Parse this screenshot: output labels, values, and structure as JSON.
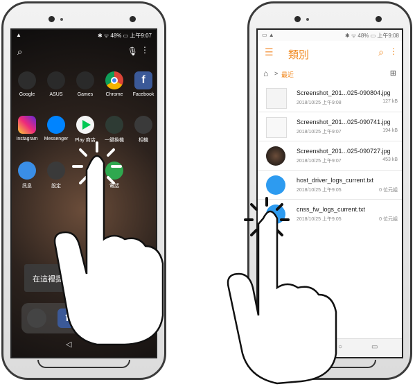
{
  "left_phone": {
    "status": {
      "left": "▲",
      "right": "✱ ᯤ 48% ▭ 上午9:07"
    },
    "apps": [
      {
        "label": "Google",
        "color": "#2d2d2d",
        "icon": "google-folder-icon"
      },
      {
        "label": "ASUS",
        "color": "#2a2a2a",
        "icon": "asus-folder-icon"
      },
      {
        "label": "Games",
        "color": "#2a2a2a",
        "icon": "games-folder-icon"
      },
      {
        "label": "Chrome",
        "color": "#e8e8e8",
        "icon": "chrome-icon"
      },
      {
        "label": "Facebook",
        "color": "#3b5998",
        "icon": "facebook-icon"
      },
      {
        "label": "Instagram",
        "color": "#c13584",
        "icon": "instagram-icon"
      },
      {
        "label": "Messenger",
        "color": "#0084ff",
        "icon": "messenger-icon"
      },
      {
        "label": "Play 商店",
        "color": "#f5f5f5",
        "icon": "play-store-icon"
      },
      {
        "label": "一鍵換機",
        "color": "#2e3b34",
        "icon": "phone-clone-icon"
      },
      {
        "label": "相機",
        "color": "#3a3a3a",
        "icon": "camera-icon"
      },
      {
        "label": "訊息",
        "color": "#3a8ee6",
        "icon": "messages-icon"
      },
      {
        "label": "設定",
        "color": "#3a3a3a",
        "icon": "settings-icon"
      },
      {
        "label": "",
        "color": "#3a3a3a",
        "icon": "hidden-app-icon"
      },
      {
        "label": "",
        "color": "#2fa84f",
        "icon": "phone-icon"
      },
      {
        "label": "電話",
        "color": "",
        "icon": ""
      }
    ],
    "tooltip_text": "在這裡提供縣",
    "nav": "◁"
  },
  "right_phone": {
    "status": {
      "left": "▭ ▲",
      "right": "✱ ᯤ 48% ▭ 上午9:08"
    },
    "title": "類別",
    "breadcrumb": {
      "separator": ">",
      "current": "最近"
    },
    "files": [
      {
        "name": "Screenshot_201...025-090804.jpg",
        "date": "2018/10/25 上午9:08",
        "size": "127 kB"
      },
      {
        "name": "Screenshot_201...025-090741.jpg",
        "date": "2018/10/25 上午9:07",
        "size": "194 kB"
      },
      {
        "name": "Screenshot_201...025-090727.jpg",
        "date": "2018/10/25 上午9:07",
        "size": "453 kB"
      },
      {
        "name": "host_driver_logs_current.txt",
        "date": "2018/10/25 上午9:05",
        "size": "0 位元組"
      },
      {
        "name": "cnss_fw_logs_current.txt",
        "date": "2018/10/25 上午9:05",
        "size": "0 位元組"
      }
    ]
  }
}
